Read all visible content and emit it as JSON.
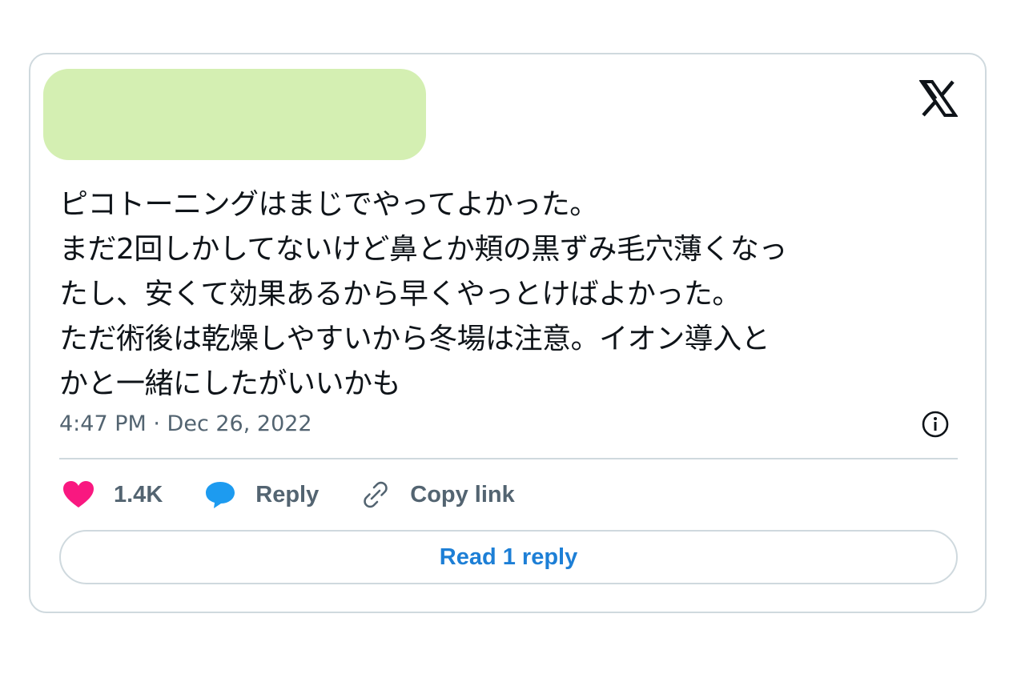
{
  "colors": {
    "redacted_block": "#d4efb2",
    "heart": "#f91880",
    "reply_bubble": "#1d9bf0",
    "link_blue": "#1d7fd6",
    "muted_text": "#536471",
    "border": "#cfd9de"
  },
  "header": {
    "logo_icon": "x-logo-icon"
  },
  "tweet": {
    "lines": [
      "ピコトーニングはまじでやってよかった。",
      "まだ2回しかしてないけど鼻とか頬の黒ずみ毛穴薄くなっ",
      "たし、安くて効果あるから早くやっとけばよかった。",
      "ただ術後は乾燥しやすいから冬場は注意。イオン導入と",
      "かと一緒にしたがいいかも"
    ],
    "timestamp": "4:47 PM · Dec 26, 2022"
  },
  "actions": {
    "like_count": "1.4K",
    "like_icon": "heart-icon",
    "reply_label": "Reply",
    "reply_icon": "speech-bubble-icon",
    "copy_label": "Copy link",
    "copy_icon": "link-icon"
  },
  "read_reply_label": "Read 1 reply"
}
